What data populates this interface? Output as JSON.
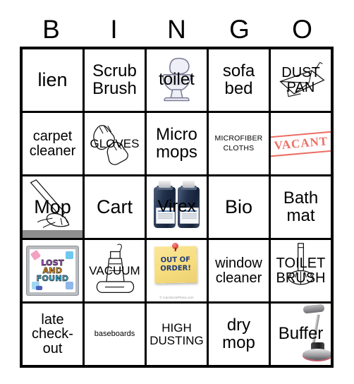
{
  "card": {
    "title": "BINGO card",
    "headers": [
      "B",
      "I",
      "N",
      "G",
      "O"
    ],
    "rows": [
      [
        {
          "text": "lien",
          "size": "xl",
          "art": "none"
        },
        {
          "text": "Scrub\nBrush",
          "size": "lg",
          "art": "none"
        },
        {
          "text": "toilet",
          "size": "lg",
          "art": "toilet-icon"
        },
        {
          "text": "sofa\nbed",
          "size": "lg",
          "art": "none"
        },
        {
          "text": "DUST\nPAN",
          "size": "md",
          "art": "dustpan-icon"
        }
      ],
      [
        {
          "text": "carpet\ncleaner",
          "size": "md",
          "art": "none"
        },
        {
          "text": "GLOVES",
          "size": "sm",
          "art": "gloves-icon"
        },
        {
          "text": "Micro\nmops",
          "size": "lg",
          "art": "none"
        },
        {
          "text": "MICROFIBER\nCLOTHS",
          "size": "xs",
          "art": "none"
        },
        {
          "text": "VACANT",
          "size": "stamp",
          "art": "vacant-stamp"
        }
      ],
      [
        {
          "text": "Mop",
          "size": "xl",
          "art": "mop-icon"
        },
        {
          "text": "Cart",
          "size": "xl",
          "art": "none"
        },
        {
          "text": "Virex",
          "size": "lg",
          "art": "virex-bottles"
        },
        {
          "text": "Bio",
          "size": "xl",
          "art": "none"
        },
        {
          "text": "Bath\nmat",
          "size": "lg",
          "art": "none"
        }
      ],
      [
        {
          "text": "LOST AND FOUND",
          "size": "board",
          "art": "lost-and-found-sign"
        },
        {
          "text": "VACUUM",
          "size": "sm",
          "art": "vacuum-icon"
        },
        {
          "text": "OUT OF ORDER!",
          "size": "note",
          "art": "out-of-order-note"
        },
        {
          "text": "window\ncleaner",
          "size": "md",
          "art": "none"
        },
        {
          "text": "TOILET\nBRUSH",
          "size": "md",
          "art": "toilet-brush-icon"
        }
      ],
      [
        {
          "text": "late\ncheck-\nout",
          "size": "md",
          "art": "none"
        },
        {
          "text": "baseboards",
          "size": "xs",
          "art": "none"
        },
        {
          "text": "HIGH\nDUSTING",
          "size": "sm",
          "art": "none"
        },
        {
          "text": "dry\nmop",
          "size": "lg",
          "art": "none"
        },
        {
          "text": "Buffer",
          "size": "lg",
          "art": "buffer-machine"
        }
      ]
    ],
    "lost_and_found": {
      "line1": "LOST",
      "line2": "AND",
      "line3": "FOUND"
    },
    "sticky_note": {
      "line1": "OUT OF",
      "line2": "ORDER!",
      "watermark": "© CanStockPhoto.com"
    },
    "colors": {
      "border": "#000000",
      "background": "#ffffff",
      "stamp_red": "#e8554a",
      "note_yellow": "#f7dd7e",
      "note_text_blue": "#1f3a7a",
      "virex_blue": "#22324c",
      "lf_purple": "#b04fd8",
      "lf_orange": "#f09a1e",
      "lf_cyan": "#2fb8e8"
    }
  }
}
